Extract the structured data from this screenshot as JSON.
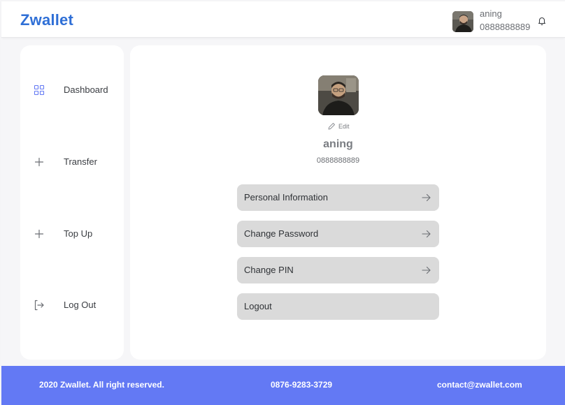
{
  "brand": {
    "name": "Zwallet"
  },
  "header": {
    "user_name": "aning",
    "user_phone": "0888888889",
    "avatar": "user-avatar-photo",
    "bell_icon": "bell-icon"
  },
  "sidebar": {
    "items": [
      {
        "label": "Dashboard",
        "icon": "grid-icon",
        "active": true
      },
      {
        "label": "Transfer",
        "icon": "plus-icon"
      },
      {
        "label": "Top Up",
        "icon": "plus-icon"
      },
      {
        "label": "Log Out",
        "icon": "logout-icon"
      }
    ]
  },
  "profile": {
    "edit_label": "Edit",
    "name": "aning",
    "phone": "0888888889",
    "menu": [
      {
        "label": "Personal Information",
        "has_arrow": true
      },
      {
        "label": "Change Password",
        "has_arrow": true
      },
      {
        "label": "Change PIN",
        "has_arrow": true
      },
      {
        "label": "Logout",
        "has_arrow": false
      }
    ]
  },
  "footer": {
    "copyright": "2020 Zwallet. All right reserved.",
    "phone": "0876-9283-3729",
    "email": "contact@zwallet.com"
  },
  "colors": {
    "brand": "#2f6fd6",
    "footer_bg": "#6379f4",
    "menu_bg": "#dadada",
    "active_icon": "#6379f4"
  }
}
